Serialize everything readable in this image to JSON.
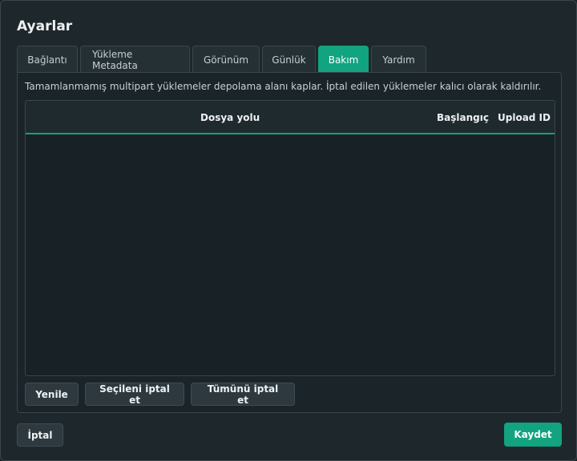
{
  "window": {
    "title": "Ayarlar"
  },
  "tabs": [
    {
      "label": "Bağlantı",
      "active": false
    },
    {
      "label": "Yükleme Metadata",
      "active": false
    },
    {
      "label": "Görünüm",
      "active": false
    },
    {
      "label": "Günlük",
      "active": false
    },
    {
      "label": "Bakım",
      "active": true
    },
    {
      "label": "Yardım",
      "active": false
    }
  ],
  "maintenance": {
    "info_text": "Tamamlanmamış multipart yüklemeler depolama alanı kaplar. İptal edilen yüklemeler kalıcı olarak kaldırılır.",
    "table": {
      "columns": [
        "Dosya yolu",
        "Başlangıç",
        "Upload ID"
      ],
      "rows": []
    },
    "buttons": {
      "refresh": "Yenile",
      "cancel_selected": "Seçileni iptal et",
      "cancel_all": "Tümünü iptal et"
    }
  },
  "footer": {
    "cancel": "İptal",
    "save": "Kaydet"
  },
  "colors": {
    "accent": "#12a380",
    "background": "#1e272c",
    "panel": "#1b2428"
  }
}
